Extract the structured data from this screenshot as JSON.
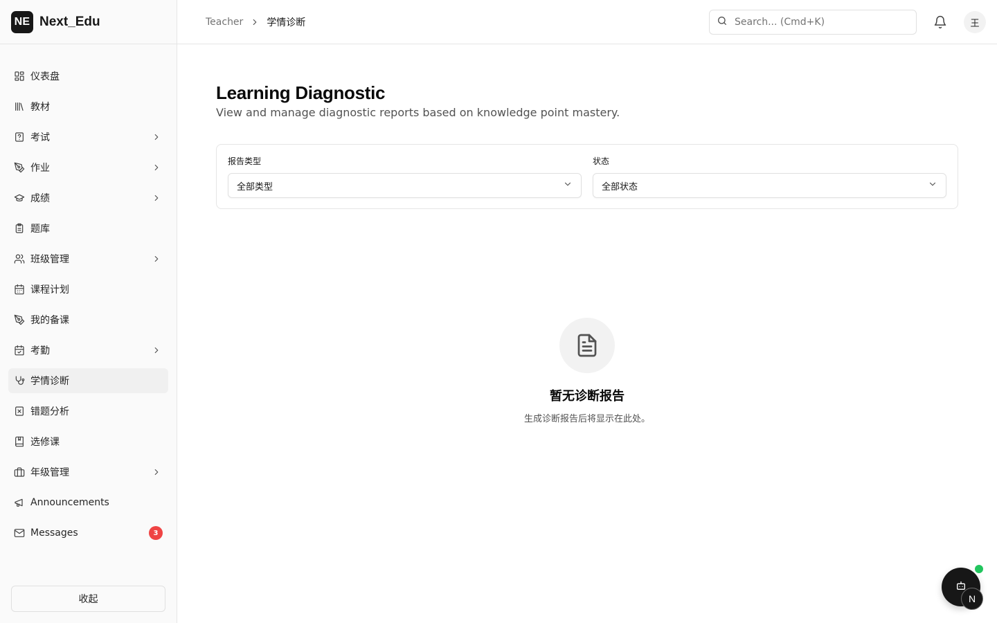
{
  "app": {
    "logo_text": "NE",
    "name": "Next_Edu"
  },
  "sidebar": {
    "items": [
      {
        "label": "仪表盘",
        "icon": "dashboard-icon",
        "has_chevron": false
      },
      {
        "label": "教材",
        "icon": "library-icon",
        "has_chevron": false
      },
      {
        "label": "考试",
        "icon": "exam-icon",
        "has_chevron": true
      },
      {
        "label": "作业",
        "icon": "pen-icon",
        "has_chevron": true
      },
      {
        "label": "成绩",
        "icon": "graduation-cap-icon",
        "has_chevron": true
      },
      {
        "label": "题库",
        "icon": "clipboard-icon",
        "has_chevron": false
      },
      {
        "label": "班级管理",
        "icon": "users-icon",
        "has_chevron": true
      },
      {
        "label": "课程计划",
        "icon": "calendar-icon",
        "has_chevron": false
      },
      {
        "label": "我的备课",
        "icon": "pen-icon",
        "has_chevron": false
      },
      {
        "label": "考勤",
        "icon": "calendar-check-icon",
        "has_chevron": true
      },
      {
        "label": "学情诊断",
        "icon": "stethoscope-icon",
        "has_chevron": false,
        "active": true
      },
      {
        "label": "错题分析",
        "icon": "x-square-icon",
        "has_chevron": false
      },
      {
        "label": "选修课",
        "icon": "book-icon",
        "has_chevron": false
      },
      {
        "label": "年级管理",
        "icon": "briefcase-icon",
        "has_chevron": true
      },
      {
        "label": "Announcements",
        "icon": "megaphone-icon",
        "has_chevron": false
      },
      {
        "label": "Messages",
        "icon": "mail-icon",
        "has_chevron": false,
        "badge": "3"
      }
    ],
    "collapse_label": "收起"
  },
  "header": {
    "breadcrumb_root": "Teacher",
    "breadcrumb_current": "学情诊断",
    "search_placeholder": "Search... (Cmd+K)",
    "avatar_text": "王"
  },
  "main": {
    "title": "Learning Diagnostic",
    "subtitle": "View and manage diagnostic reports based on knowledge point mastery.",
    "filters": [
      {
        "label": "报告类型",
        "value": "全部类型"
      },
      {
        "label": "状态",
        "value": "全部状态"
      }
    ],
    "empty": {
      "title": "暂无诊断报告",
      "description": "生成诊断报告后将显示在此处。"
    }
  },
  "assistant": {
    "badge_text": "N"
  },
  "colors": {
    "badge": "#ef4444",
    "online": "#22c55e",
    "brand": "#171717"
  }
}
